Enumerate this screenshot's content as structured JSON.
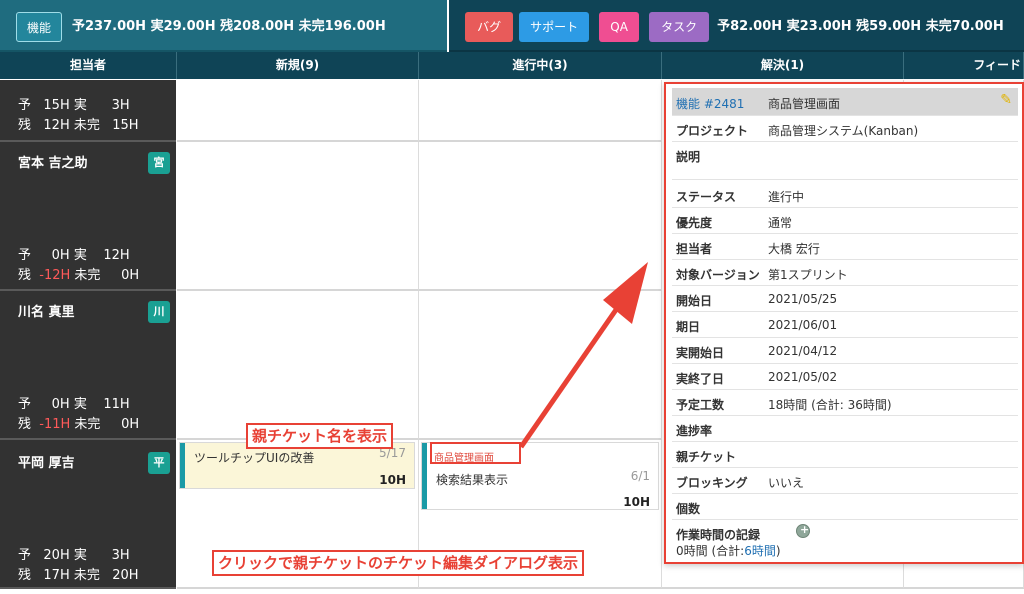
{
  "topbar": {
    "left_tag": "機能",
    "left_stats": "予237.00H 実29.00H 残208.00H 未完196.00H",
    "right_tags": [
      "バグ",
      "サポート",
      "QA",
      "タスク"
    ],
    "right_stats": "予82.00H 実23.00H 残59.00H 未完70.00H"
  },
  "columns": [
    "担当者",
    "新規(9)",
    "進行中(3)",
    "解決(1)",
    "フィード"
  ],
  "rows": [
    {
      "name": "",
      "badge": "",
      "yo": "予   15H 実      3H",
      "zan_prefix": "残   ",
      "zan": "12H",
      "zan_suffix": " 未完   15H",
      "zan_neg": false
    },
    {
      "name": "宮本 吉之助",
      "badge": "宮",
      "yo": "予     0H 実    12H",
      "zan_prefix": "残  ",
      "zan": "-12H",
      "zan_suffix": " 未完     0H",
      "zan_neg": true
    },
    {
      "name": "川名 真里",
      "badge": "川",
      "yo": "予     0H 実    11H",
      "zan_prefix": "残  ",
      "zan": "-11H",
      "zan_suffix": " 未完     0H",
      "zan_neg": true
    },
    {
      "name": "平岡 厚吉",
      "badge": "平",
      "yo": "予   20H 実      3H",
      "zan_prefix": "残   ",
      "zan": "17H",
      "zan_suffix": " 未完   20H",
      "zan_neg": false
    }
  ],
  "cards": {
    "card1": {
      "title": "ツールチップUIの改善",
      "count": "5/17",
      "hours": "10H"
    },
    "card2": {
      "parent": "商品管理画面",
      "title": "検索結果表示",
      "count": "6/1",
      "hours": "10H"
    }
  },
  "detail": {
    "header_id": "機能 #2481",
    "header_title": "商品管理画面",
    "rows": [
      {
        "key": "プロジェクト",
        "value": "商品管理システム(Kanban)"
      },
      {
        "key": "説明",
        "value": ""
      },
      {
        "key": "ステータス",
        "value": "進行中"
      },
      {
        "key": "優先度",
        "value": "通常"
      },
      {
        "key": "担当者",
        "value": "大橋 宏行"
      },
      {
        "key": "対象バージョン",
        "value": "第1スプリント"
      },
      {
        "key": "開始日",
        "value": "2021/05/25"
      },
      {
        "key": "期日",
        "value": "2021/06/01"
      },
      {
        "key": "実開始日",
        "value": "2021/04/12"
      },
      {
        "key": "実終了日",
        "value": "2021/05/02"
      },
      {
        "key": "予定工数",
        "value": "18時間 (合計: 36時間)"
      },
      {
        "key": "進捗率",
        "value": ""
      },
      {
        "key": "親チケット",
        "value": ""
      },
      {
        "key": "ブロッキング",
        "value": "いいえ"
      },
      {
        "key": "個数",
        "value": ""
      }
    ],
    "worklog_key": "作業時間の記録",
    "worklog_prefix": "0時間 (合計:",
    "worklog_link": "6時間",
    "worklog_suffix": ")"
  },
  "annotations": {
    "parent_name": "親チケット名を表示",
    "click_hint": "クリックで親チケットのチケット編集ダイアログ表示"
  }
}
